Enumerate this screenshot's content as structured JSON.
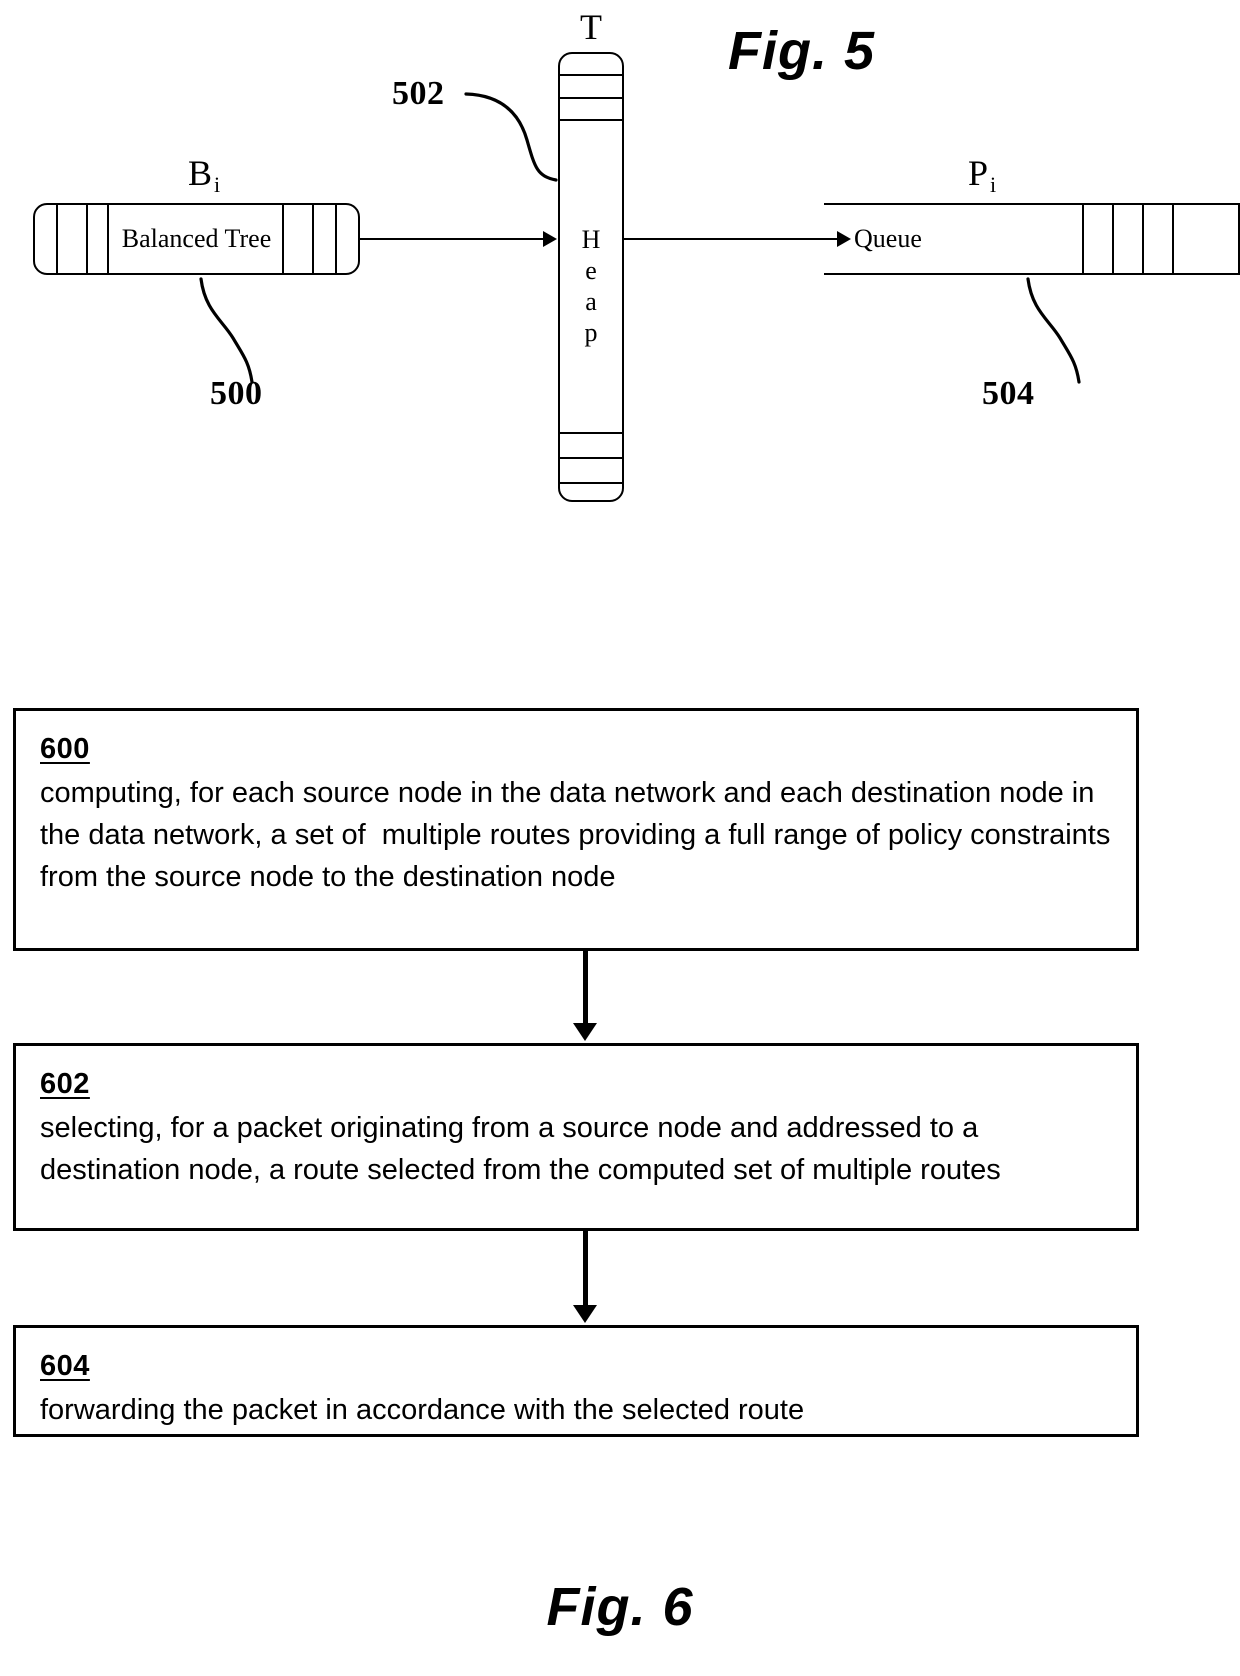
{
  "figure5": {
    "caption": "Fig. 5",
    "labels": {
      "balanced_tree_symbol": "B",
      "balanced_tree_subscript": "i",
      "queue_symbol": "P",
      "queue_subscript": "i",
      "heap_symbol": "T"
    },
    "blocks": {
      "balanced_tree": "Balanced Tree",
      "heap": "Heap",
      "queue": "Queue"
    },
    "reference_numerals": {
      "balanced_tree": "500",
      "heap": "502",
      "queue": "504"
    }
  },
  "figure6": {
    "caption": "Fig. 6",
    "steps": [
      {
        "number": "600",
        "text": "computing, for each source node in the data network and each destination node in the data network, a set of  multiple routes providing a full range of policy constraints from the source node to the destination node"
      },
      {
        "number": "602",
        "text": "selecting, for a packet originating from a source node and addressed to a destination node, a route selected from the computed set of multiple routes"
      },
      {
        "number": "604",
        "text": "forwarding the packet in accordance with the selected route"
      }
    ]
  },
  "colors": {
    "ink": "#000000",
    "paper": "#ffffff"
  }
}
